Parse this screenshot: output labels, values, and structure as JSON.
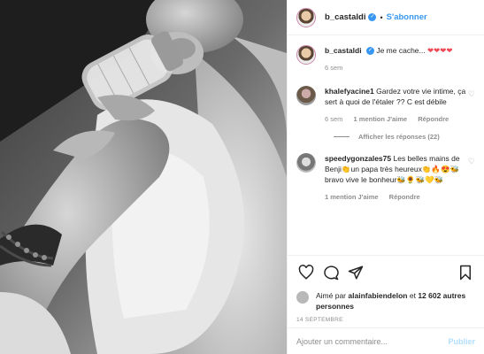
{
  "header": {
    "username": "b_castaldi",
    "verified_mark": "✓",
    "separator": "•",
    "follow_label": "S'abonner"
  },
  "caption": {
    "username": "b_castaldi",
    "text": "Je me cache...",
    "emoji": "❤❤❤❤",
    "time": "6 sem"
  },
  "comments": [
    {
      "username": "khalefyacine1",
      "text": "Gardez votre vie intime, ça sert à quoi de l'étaler ?? C est débile",
      "time": "6 sem",
      "likes": "1 mention J'aime",
      "reply": "Répondre",
      "view_replies": "Afficher les réponses (22)"
    },
    {
      "username": "speedygonzales75",
      "text": "Les belles mains de Benji👏un papa très heureux👏🔥😍🐝bravo vive le bonheur🐝🌻🐝💛🐝",
      "time": "",
      "likes": "1 mention J'aime",
      "reply": "Répondre"
    }
  ],
  "icons": {
    "like": "heart-outline-icon",
    "comment": "comment-icon",
    "share": "paper-plane-icon",
    "save": "bookmark-icon"
  },
  "likes": {
    "prefix": "Aimé par",
    "user": "alainfabiendelon",
    "and": "et",
    "others": "12 602 autres personnes"
  },
  "date": "14 SEPTEMBRE",
  "add_comment": {
    "placeholder": "Ajouter un commentaire...",
    "publish_label": "Publier"
  },
  "colors": {
    "accent": "#3897f0",
    "heart_red": "#ed4956",
    "muted": "#8e8e8e",
    "publish_disabled": "#b2dffc"
  }
}
